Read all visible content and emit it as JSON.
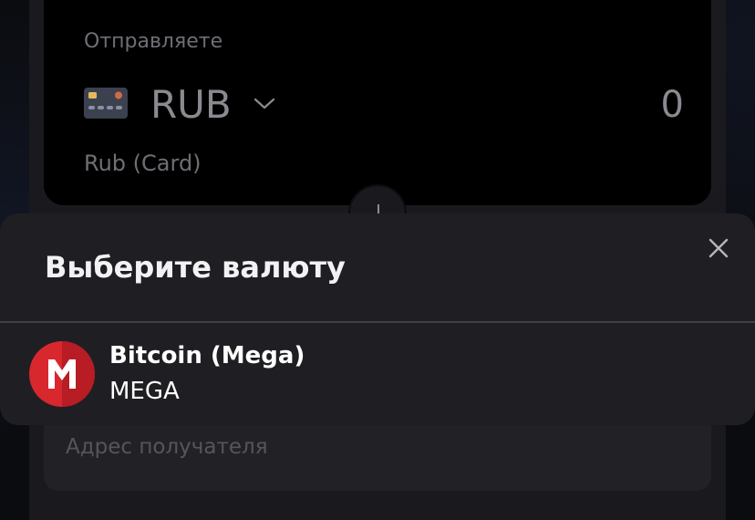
{
  "exchange_form": {
    "send": {
      "label": "Отправляете",
      "currency_code": "RUB",
      "currency_name": "Rub (Card)",
      "amount": "0",
      "icon": "credit-card-icon"
    },
    "swap_icon": "swap-arrows-icon",
    "recipient": {
      "placeholder": "Адрес получателя"
    }
  },
  "currency_sheet": {
    "title": "Выберите валюту",
    "close_icon": "close-icon",
    "items": [
      {
        "name": "Bitcoin (Mega)",
        "code": "MEGA",
        "icon": "mega-logo-icon",
        "color": "#d9272e"
      }
    ]
  },
  "colors": {
    "background": "#0b0c10",
    "panel": "#1a1a1e",
    "card": "#000000",
    "sheet": "#1f1f23",
    "muted_text": "#6e6f75",
    "accent_red": "#d9272e"
  }
}
